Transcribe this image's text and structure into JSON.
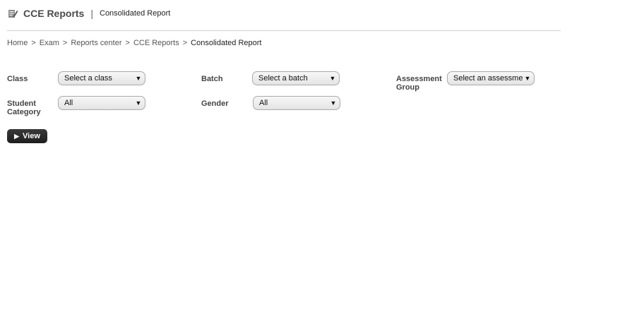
{
  "header": {
    "title": "CCE Reports",
    "separator": "|",
    "subtitle": "Consolidated Report",
    "icon": "edit-report-icon"
  },
  "breadcrumb": {
    "items": [
      "Home",
      "Exam",
      "Reports center",
      "CCE Reports"
    ],
    "current": "Consolidated Report",
    "separator": ">"
  },
  "form": {
    "class_label": "Class",
    "class_value": "Select a class",
    "batch_label": "Batch",
    "batch_value": "Select a batch",
    "assessment_label_line1": "Assessment",
    "assessment_label_line2": "Group",
    "assessment_value": "Select an assessme",
    "category_label_line1": "Student",
    "category_label_line2": "Category",
    "category_value": "All",
    "gender_label": "Gender",
    "gender_value": "All",
    "dropdown_arrow": "▼"
  },
  "actions": {
    "view_label": "View",
    "view_icon": "▶"
  }
}
